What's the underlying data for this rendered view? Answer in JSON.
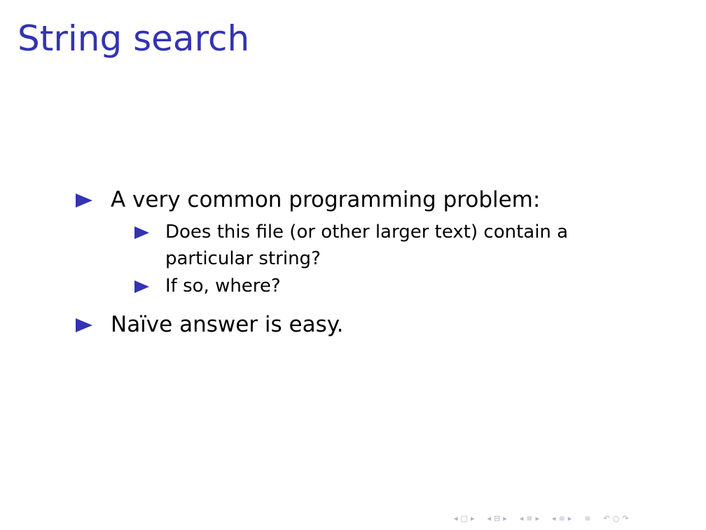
{
  "slide": {
    "title": "String search",
    "bullets": [
      {
        "text": "A very common programming problem:",
        "sub": [
          {
            "lines": [
              "Does this file (or other larger text) contain a",
              "particular string?"
            ]
          },
          {
            "lines": [
              "If so, where?"
            ]
          }
        ]
      },
      {
        "text": "Naïve answer is easy."
      }
    ]
  },
  "colors": {
    "title": "#3333b3",
    "bullet_marker": "#3333b3",
    "text": "#000000",
    "nav_icons": "#b0b0c8"
  },
  "navigation": {
    "icons": [
      "first-frame-left-icon",
      "frame-icon",
      "next-frame-right-icon",
      "prev-subsection-left-icon",
      "subsection-icon",
      "next-subsection-right-icon",
      "prev-section-left-icon",
      "section-icon",
      "next-section-right-icon",
      "prev-part-left-icon",
      "part-icon",
      "next-part-right-icon",
      "appendix-icon",
      "search-backward-icon",
      "search-icon",
      "search-forward-icon"
    ]
  }
}
